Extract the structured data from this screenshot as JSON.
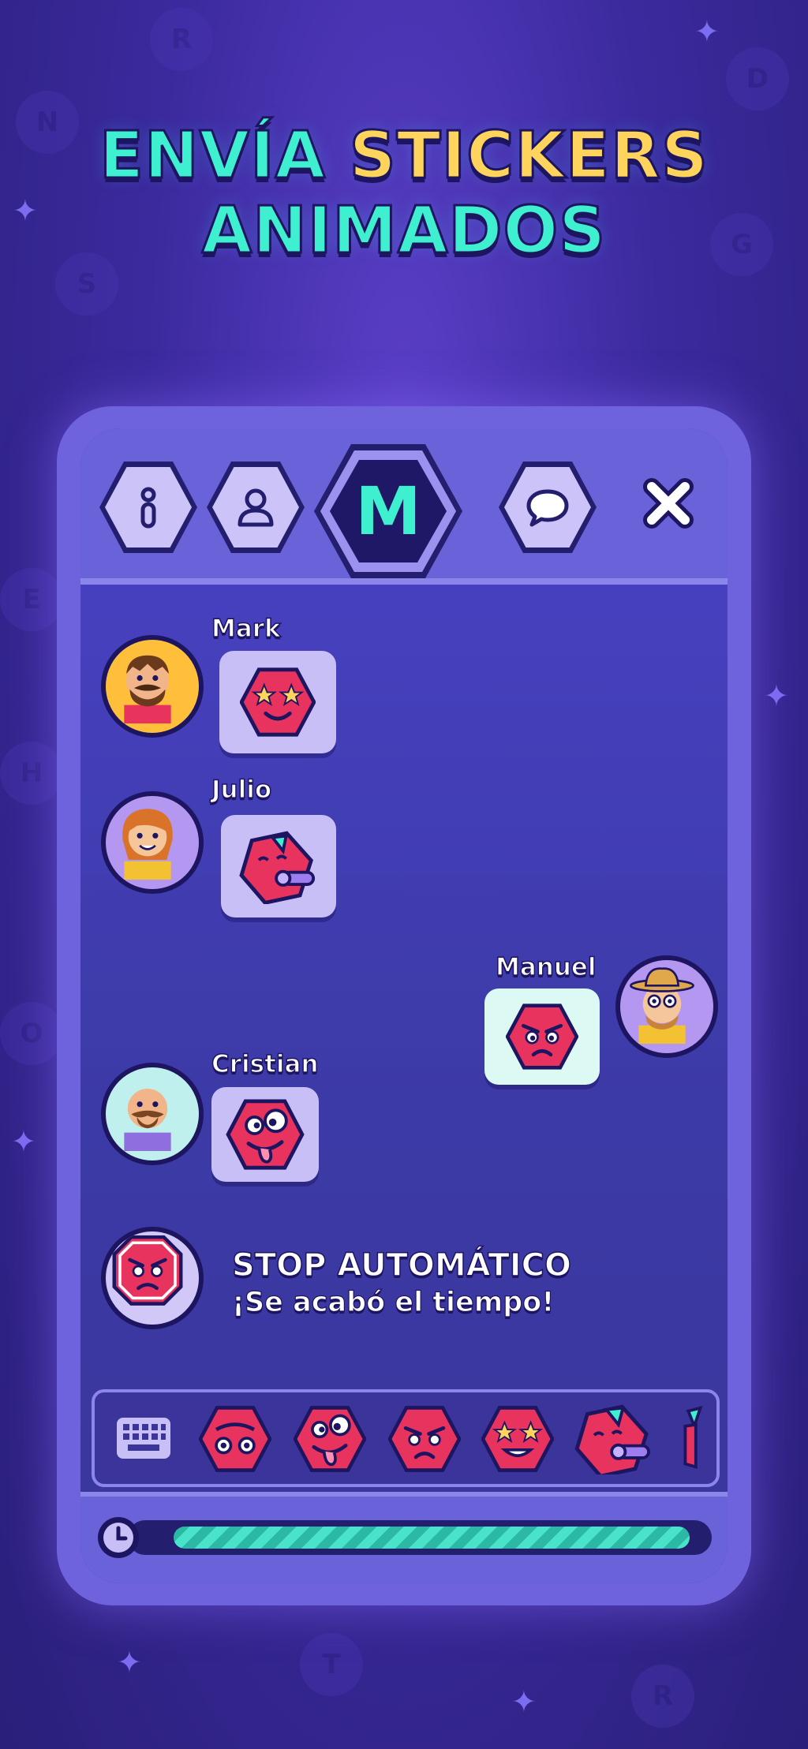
{
  "headline": {
    "part1": "ENVÍA ",
    "part2": "STICKERS",
    "line2": "ANIMADOS"
  },
  "tabs": [
    {
      "name": "info-icon"
    },
    {
      "name": "user-icon"
    },
    {
      "name": "m-logo",
      "letter": "M"
    },
    {
      "name": "chat-icon"
    }
  ],
  "messages": [
    {
      "name": "Mark",
      "side": "left"
    },
    {
      "name": "Julio",
      "side": "left"
    },
    {
      "name": "Manuel",
      "side": "right"
    },
    {
      "name": "Cristian",
      "side": "left"
    }
  ],
  "system_message": {
    "title": "STOP AUTOMÁTICO",
    "subtitle": "¡Se acabó el tiempo!"
  },
  "colors": {
    "accent_teal": "#3ef0cf",
    "accent_yellow": "#ffd45c",
    "sticker_red": "#e8335f",
    "navy": "#1d1560"
  },
  "timer": {
    "progress": 0.97
  }
}
